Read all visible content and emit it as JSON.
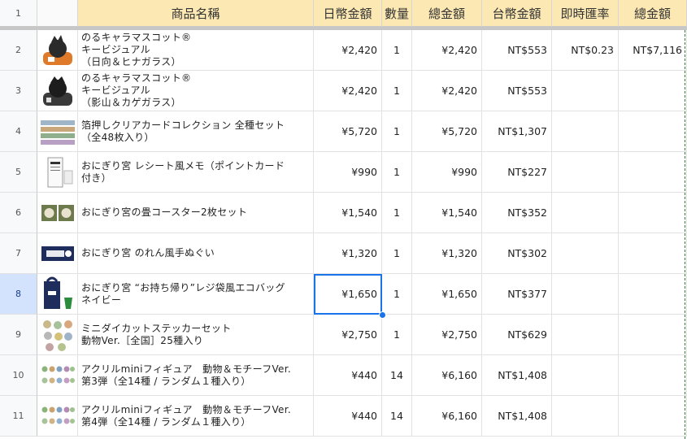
{
  "header": {
    "row_number": "1",
    "columns": [
      "",
      "商品名稱",
      "日幣金額",
      "數量",
      "總金額",
      "台幣金額",
      "即時匯率",
      "總金額"
    ]
  },
  "rows": [
    {
      "num": "2",
      "name": "のるキャラマスコット®\nキービジュアル\n（日向＆ヒナガラス）",
      "jpy": "¥2,420",
      "qty": "1",
      "total": "¥2,420",
      "twd": "NT$553",
      "rate": "NT$0.23",
      "sum": "NT$7,116",
      "icon": "orange-crow-mascot-icon"
    },
    {
      "num": "3",
      "name": "のるキャラマスコット®\nキービジュアル\n（影山＆カゲガラス）",
      "jpy": "¥2,420",
      "qty": "1",
      "total": "¥2,420",
      "twd": "NT$553",
      "rate": "",
      "sum": "",
      "icon": "black-crow-mascot-icon"
    },
    {
      "num": "4",
      "name": "箔押しクリアカードコレクション 全種セット\n（全48枚入り）",
      "jpy": "¥5,720",
      "qty": "1",
      "total": "¥5,720",
      "twd": "NT$1,307",
      "rate": "",
      "sum": "",
      "icon": "card-collection-icon"
    },
    {
      "num": "5",
      "name": "おにぎり宮 レシート風メモ（ポイントカード\n付き）",
      "jpy": "¥990",
      "qty": "1",
      "total": "¥990",
      "twd": "NT$227",
      "rate": "",
      "sum": "",
      "icon": "receipt-memo-icon"
    },
    {
      "num": "6",
      "name": "おにぎり宮の畳コースター2枚セット",
      "jpy": "¥1,540",
      "qty": "1",
      "total": "¥1,540",
      "twd": "NT$352",
      "rate": "",
      "sum": "",
      "icon": "coaster-icon"
    },
    {
      "num": "7",
      "name": "おにぎり宮 のれん風手ぬぐい",
      "jpy": "¥1,320",
      "qty": "1",
      "total": "¥1,320",
      "twd": "NT$302",
      "rate": "",
      "sum": "",
      "icon": "towel-icon"
    },
    {
      "num": "8",
      "name": "おにぎり宮 “お持ち帰り”レジ袋風エコバッグ\nネイビー",
      "jpy": "¥1,650",
      "qty": "1",
      "total": "¥1,650",
      "twd": "NT$377",
      "rate": "",
      "sum": "",
      "icon": "eco-bag-icon",
      "selected": true
    },
    {
      "num": "9",
      "name": "ミニダイカットステッカーセット\n動物Ver.［全国］25種入り",
      "jpy": "¥2,750",
      "qty": "1",
      "total": "¥2,750",
      "twd": "NT$629",
      "rate": "",
      "sum": "",
      "icon": "sticker-set-icon"
    },
    {
      "num": "10",
      "name": "アクリルminiフィギュア　動物＆モチーフVer.\n第3弾（全14種 / ランダム１種入り）",
      "jpy": "¥440",
      "qty": "14",
      "total": "¥6,160",
      "twd": "NT$1,408",
      "rate": "",
      "sum": "",
      "icon": "acrylic-figure-icon"
    },
    {
      "num": "11",
      "name": "アクリルminiフィギュア　動物＆モチーフVer.\n第4弾（全14種 / ランダム１種入り）",
      "jpy": "¥440",
      "qty": "14",
      "total": "¥6,160",
      "twd": "NT$1,408",
      "rate": "",
      "sum": "",
      "icon": "acrylic-figure-icon"
    }
  ],
  "colors": {
    "header_yellow": "#fce8b2",
    "selection_blue": "#1a73e8",
    "selected_row_header": "#d3e3fd"
  }
}
